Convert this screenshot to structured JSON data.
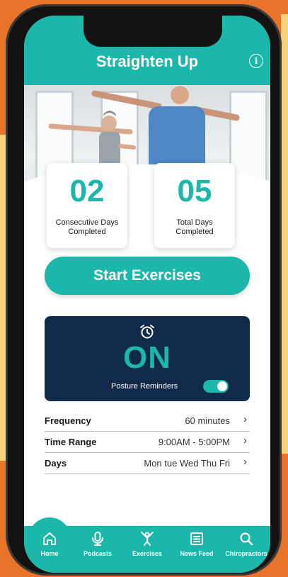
{
  "header": {
    "title": "Straighten Up",
    "info_icon": "info-icon"
  },
  "stats": [
    {
      "value": "02",
      "label": "Consecutive Days Completed"
    },
    {
      "value": "05",
      "label": "Total Days Completed"
    }
  ],
  "start_button": {
    "label": "Start Exercises"
  },
  "reminder": {
    "icon": "alarm-clock-icon",
    "state": "ON",
    "label": "Posture Reminders",
    "enabled": true
  },
  "settings": [
    {
      "label": "Frequency",
      "value": "60 minutes"
    },
    {
      "label": "Time Range",
      "value": "9:00AM - 5:00PM"
    },
    {
      "label": "Days",
      "value": "Mon tue Wed Thu Fri"
    }
  ],
  "tabs": [
    {
      "label": "Home",
      "icon": "home-icon"
    },
    {
      "label": "Podcasts",
      "icon": "microphone-icon"
    },
    {
      "label": "Exercises",
      "icon": "exercise-icon"
    },
    {
      "label": "News Feed",
      "icon": "newspaper-icon"
    },
    {
      "label": "Chiropractors",
      "icon": "search-icon"
    }
  ],
  "colors": {
    "accent": "#1ab7aa",
    "navy": "#112a4b",
    "background": "#e8742a"
  }
}
